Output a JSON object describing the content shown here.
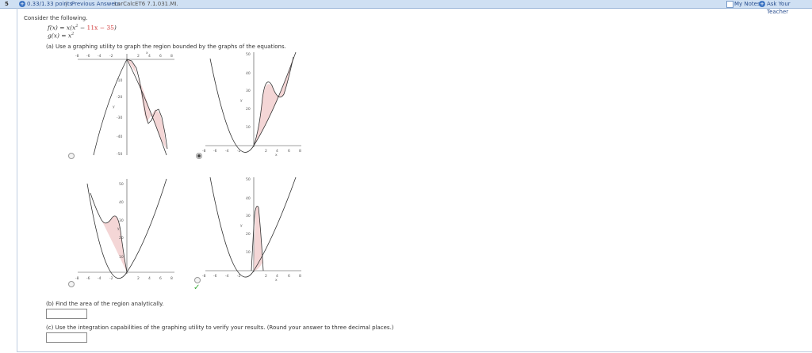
{
  "header": {
    "question_number": "5",
    "plus_icon": "+",
    "points": "0.33/1.33 points",
    "separator": "|",
    "previous_answers": "Previous Answers",
    "problem_id": "LarCalcET6 7.1.031.MI.",
    "my_notes": "My Notes",
    "ask_teacher": "Ask Your Teacher"
  },
  "problem": {
    "intro": "Consider the following.",
    "f_lhs": "f(x) = x(x",
    "f_sup": "2",
    "f_mid": " − ",
    "f_red": "11x − 35",
    "f_end": ")",
    "g_lhs": "g(x) = x",
    "g_sup": "2",
    "part_a": "(a) Use a graphing utility to graph the region bounded by the graphs of the equations.",
    "part_b": "(b) Find the area of the region analytically.",
    "part_c": "(c) Use the integration capabilities of the graphing utility to verify your results. (Round your answer to three decimal places.)",
    "answer_b": "",
    "answer_c": ""
  },
  "graphs": [
    {
      "id": "a",
      "selected": false,
      "correct": false,
      "x_ticks": [
        "-8",
        "-6",
        "-4",
        "-2",
        "2",
        "4",
        "6",
        "8"
      ],
      "y_ticks": [
        "-10",
        "-20",
        "-30",
        "-40",
        "-50"
      ],
      "x_label": "x",
      "y_label": "y"
    },
    {
      "id": "b",
      "selected": true,
      "correct": false,
      "x_ticks": [
        "-8",
        "-6",
        "-4",
        "-2",
        "2",
        "4",
        "6",
        "8"
      ],
      "y_ticks": [
        "50",
        "40",
        "30",
        "20",
        "10"
      ],
      "x_label": "x",
      "y_label": "y"
    },
    {
      "id": "c",
      "selected": false,
      "correct": false,
      "x_ticks": [
        "-8",
        "-6",
        "-4",
        "-2",
        "2",
        "4",
        "6",
        "8"
      ],
      "y_ticks": [
        "50",
        "40",
        "30",
        "20",
        "10"
      ],
      "x_label": "x",
      "y_label": "y"
    },
    {
      "id": "d",
      "selected": false,
      "correct": true,
      "x_ticks": [
        "-8",
        "-6",
        "-4",
        "-2",
        "2",
        "4",
        "6",
        "8"
      ],
      "y_ticks": [
        "50",
        "40",
        "30",
        "20",
        "10"
      ],
      "x_label": "x",
      "y_label": "y"
    }
  ],
  "colors": {
    "shade": "#f4d6d6",
    "shade_stroke": "#c06060",
    "curve": "#333333",
    "check": "#3aaa3a",
    "header_bg": "#cfe0f3"
  }
}
